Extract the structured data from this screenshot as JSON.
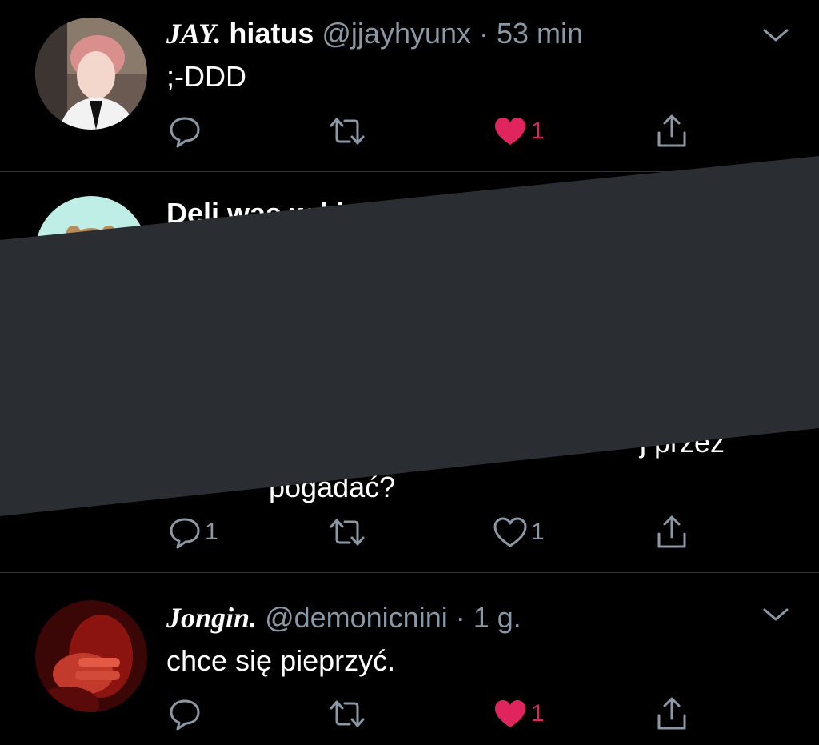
{
  "tweets": [
    {
      "display_name": "JAY.",
      "name_suffix": " hiatus",
      "handle": "@jjayhyunx",
      "separator": " · ",
      "time": "53 min",
      "text": ";-DDD",
      "replies": "",
      "likes": "1",
      "liked": true
    },
    {
      "display_name": "Deli was w ki",
      "text_line1": "j przez",
      "text_line2": "pogadać?",
      "replies": "1",
      "likes": "1",
      "liked": false
    },
    {
      "display_name": "Jongin.",
      "handle": "@demonicnini",
      "separator": " · ",
      "time": "1 g.",
      "text": "chce się pieprzyć.",
      "replies": "",
      "likes": "1",
      "liked": true
    }
  ],
  "icons": [
    "reply-icon",
    "retweet-icon",
    "like-icon",
    "share-icon",
    "chevron-down-icon"
  ],
  "colors": {
    "background": "#000000",
    "like_active": "#e0245e",
    "muted": "#8b98a5",
    "redaction": "#2a2d31"
  }
}
